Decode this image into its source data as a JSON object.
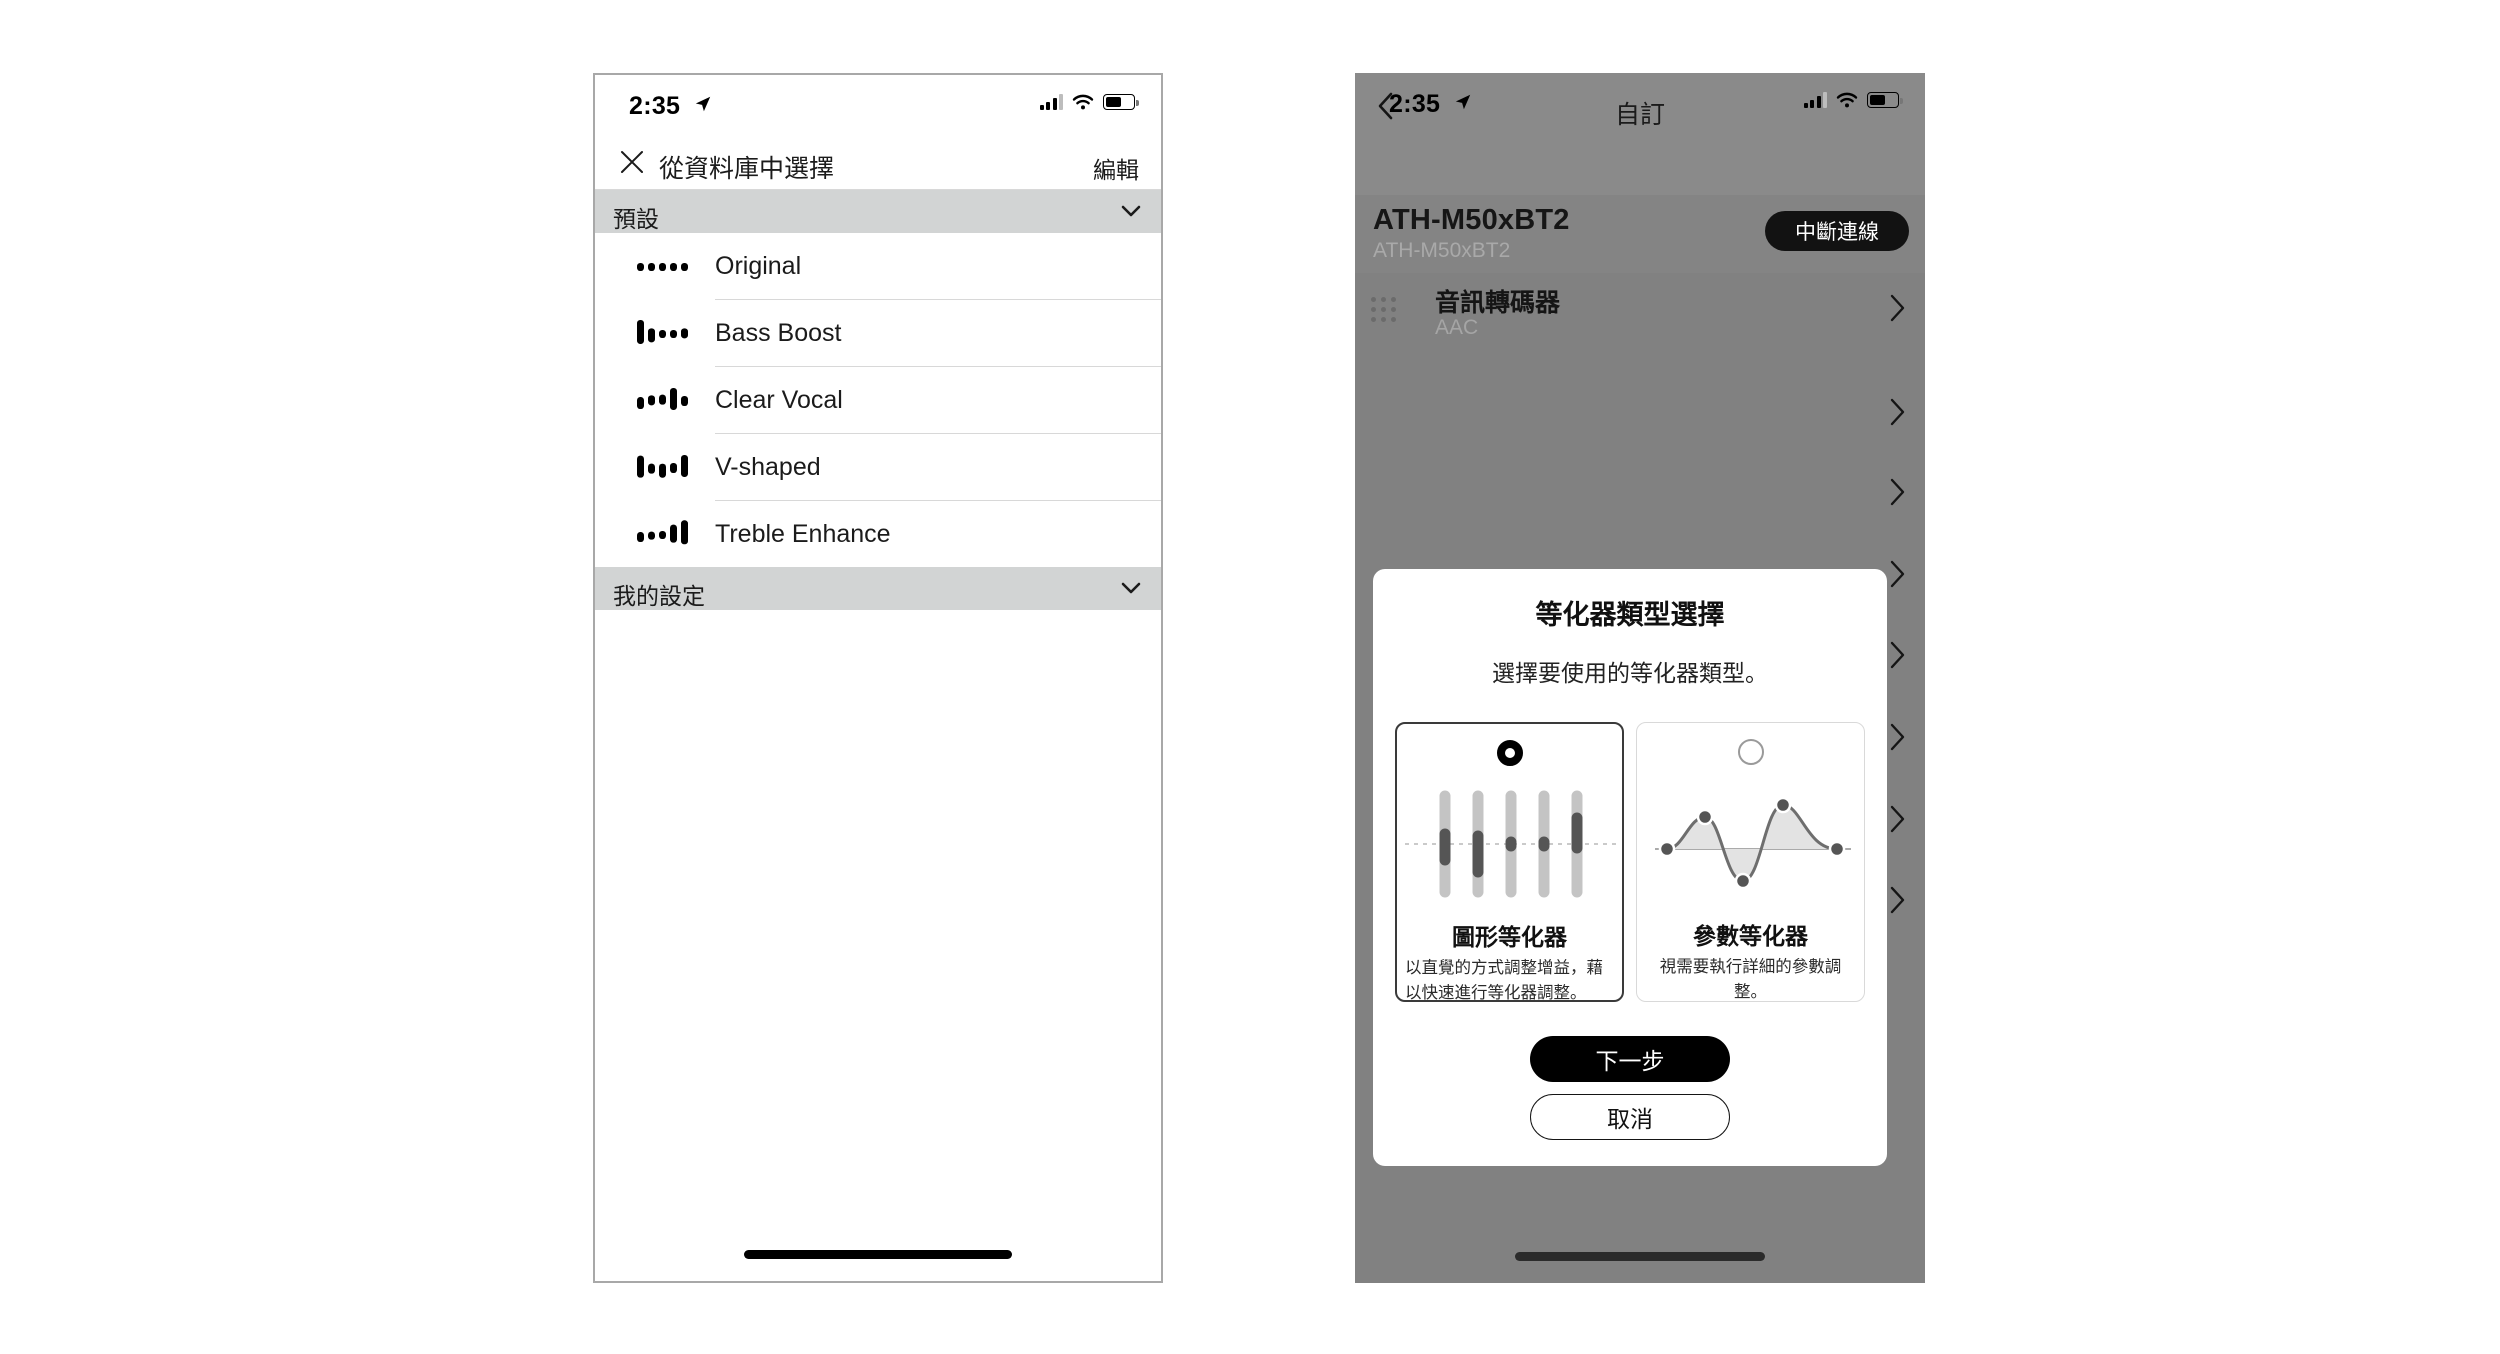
{
  "left_phone": {
    "status_bar": {
      "time": "2:35",
      "location_icon": "location-arrow-icon",
      "signal_icon": "cellular-signal-icon",
      "wifi_icon": "wifi-icon",
      "battery_icon": "battery-icon"
    },
    "navbar": {
      "close_icon": "close-x-icon",
      "title": "從資料庫中選擇",
      "edit_label": "編輯"
    },
    "sections": [
      {
        "label": "預設",
        "chevron": "chevron-down-icon",
        "presets": [
          {
            "name": "Original",
            "bars": [
              26,
              26,
              26,
              26,
              26
            ],
            "offsets": [
              0,
              0,
              0,
              0,
              0
            ]
          },
          {
            "name": "Bass Boost",
            "bars": [
              72,
              40,
              26,
              26,
              30
            ],
            "offsets": [
              -6,
              4,
              0,
              0,
              -2
            ]
          },
          {
            "name": "Clear Vocal",
            "bars": [
              34,
              30,
              30,
              62,
              32
            ],
            "offsets": [
              6,
              -2,
              -4,
              -6,
              0
            ]
          },
          {
            "name": "V-shaped",
            "bars": [
              62,
              30,
              40,
              30,
              62
            ],
            "offsets": [
              -4,
              2,
              8,
              0,
              -6
            ]
          },
          {
            "name": "Treble Enhance",
            "bars": [
              30,
              26,
              26,
              52,
              72
            ],
            "offsets": [
              6,
              2,
              0,
              -4,
              -8
            ]
          }
        ]
      },
      {
        "label": "我的設定",
        "chevron": "chevron-down-icon",
        "presets": []
      }
    ],
    "home_indicator": "home-indicator"
  },
  "right_phone": {
    "status_bar": {
      "time": "2:35"
    },
    "navbar": {
      "back_icon": "chevron-left-icon",
      "title": "自訂"
    },
    "device": {
      "name": "ATH-M50xBT2",
      "model": "ATH-M50xBT2",
      "disconnect_label": "中斷連線"
    },
    "codec_row": {
      "icon": "dot-grid-icon",
      "title": "音訊轉碼器",
      "value": "AAC",
      "chevron": "chevron-right-icon"
    },
    "background_rows_chevrons": 7,
    "modal": {
      "title": "等化器類型選擇",
      "description": "選擇要使用的等化器類型。",
      "options": [
        {
          "id": "graphic",
          "selected": true,
          "title": "圖形等化器",
          "description": "以直覺的方式調整增益，藉以快速進行等化器調整。",
          "art": "graphic-eq-sliders"
        },
        {
          "id": "parametric",
          "selected": false,
          "title": "參數等化器",
          "description": "視需要執行詳細的參數調整。",
          "art": "parametric-eq-curve"
        }
      ],
      "primary_button": "下一步",
      "secondary_button": "取消"
    },
    "home_indicator": "home-indicator"
  },
  "colors": {
    "section_header_bg": "#d2d4d4",
    "dim_overlay": "#808080",
    "accent_black": "#000000",
    "muted_text": "#a5a5a5"
  }
}
